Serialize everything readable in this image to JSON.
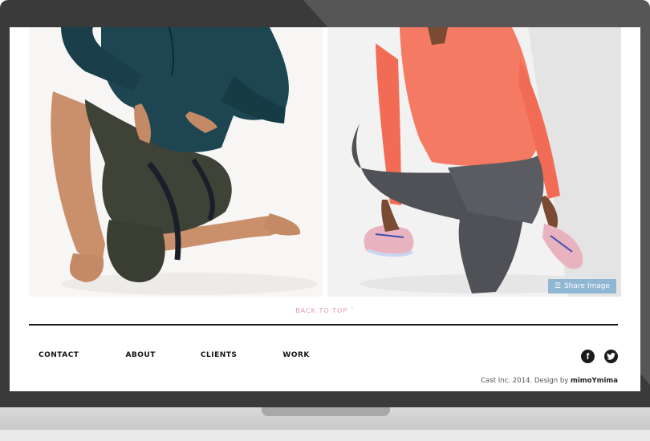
{
  "photos": {
    "share_label": "Share Image"
  },
  "back_to_top": "BACK TO TOP ˄",
  "footer": {
    "nav": [
      "CONTACT",
      "ABOUT",
      "CLIENTS",
      "WORK"
    ],
    "credit_prefix": "Cast Inc. 2014. Design by ",
    "credit_author": "mimoYmima"
  },
  "social": {
    "facebook_glyph": "f",
    "twitter_glyph": "t",
    "icon_names": [
      "facebook-icon",
      "twitter-icon"
    ]
  },
  "colors": {
    "bezel": "#3a3a3a",
    "share_button": "#8fb6d3",
    "back_to_top": "#e79ab0",
    "jacket_teal": "#1d4652",
    "top_coral": "#f47a63"
  }
}
